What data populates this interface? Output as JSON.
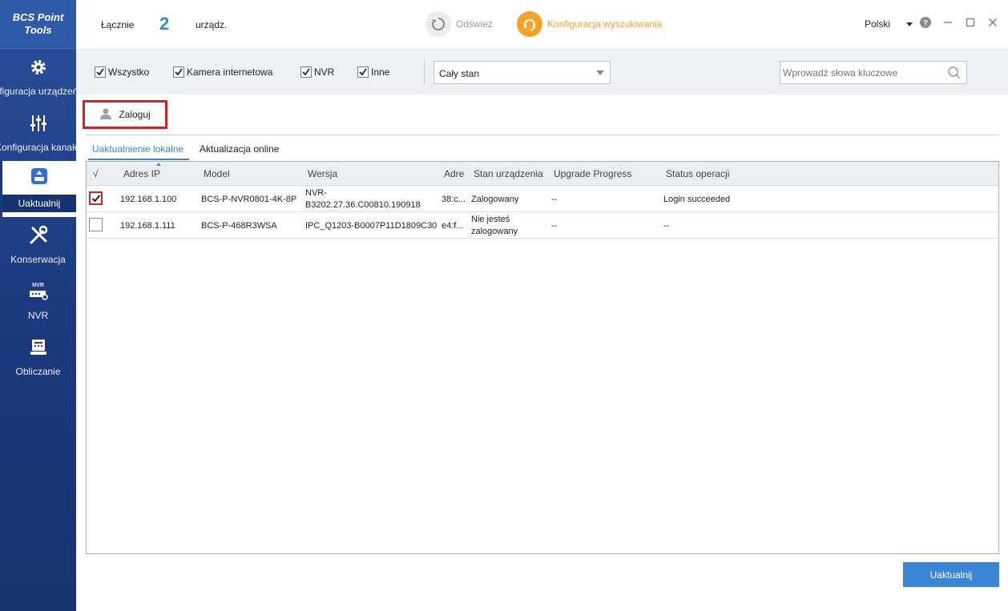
{
  "app": {
    "logo_line1": "BCS Point",
    "logo_line2": "Tools"
  },
  "sidebar": {
    "items": [
      {
        "label": "Konfiguracja urządzeń",
        "icon": "gear-icon"
      },
      {
        "label": "Konfiguracja kanału",
        "icon": "sliders-icon"
      },
      {
        "label": "Uaktualnij",
        "icon": "upgrade-icon",
        "active": true
      },
      {
        "label": "Konserwacja",
        "icon": "tools-icon"
      },
      {
        "label": "NVR",
        "icon": "nvr-icon",
        "badge": "NVR"
      },
      {
        "label": "Obliczanie",
        "icon": "calculator-icon"
      }
    ]
  },
  "header": {
    "total_label": "Łącznie",
    "total_count": "2",
    "total_unit": "urządz.",
    "refresh_label": "Odśwież",
    "search_config_label": "Konfiguracja wyszukiwania",
    "language": "Polski"
  },
  "filters": {
    "all": "Wszystko",
    "ipc": "Kamera internetowa",
    "nvr": "NVR",
    "other": "Inne",
    "status_select": "Cały stan",
    "search_placeholder": "Wprowadź słowa kluczowe"
  },
  "login_button": "Zaloguj",
  "tabs": {
    "local": "Uaktualnienie lokalne",
    "online": "Aktualizacja online"
  },
  "table": {
    "headers": {
      "check": "√",
      "ip": "Adres IP",
      "model": "Model",
      "version": "Wersja",
      "mac": "Adres MAC",
      "state": "Stan urządzenia",
      "progress": "Upgrade Progress",
      "op_status": "Status operacji"
    },
    "rows": [
      {
        "checked": true,
        "ip": "192.168.1.100",
        "model": "BCS-P-NVR0801-4K-8P",
        "version_line1": "NVR-",
        "version_line2": "B3202.27.36.C00810.190918",
        "mac": "38:c...",
        "state_line1": "Zalogowany",
        "state_line2": "",
        "progress": "--",
        "op_status": "Login succeeded"
      },
      {
        "checked": false,
        "ip": "192.168.1.111",
        "model": "BCS-P-468R3WSA",
        "version_line1": "IPC_Q1203-B0007P11D1809C30",
        "version_line2": "",
        "mac": "e4:f...",
        "state_line1": "Nie jesteś",
        "state_line2": "zalogowany",
        "progress": "--",
        "op_status": "--"
      }
    ]
  },
  "update_button": "Uaktualnij"
}
